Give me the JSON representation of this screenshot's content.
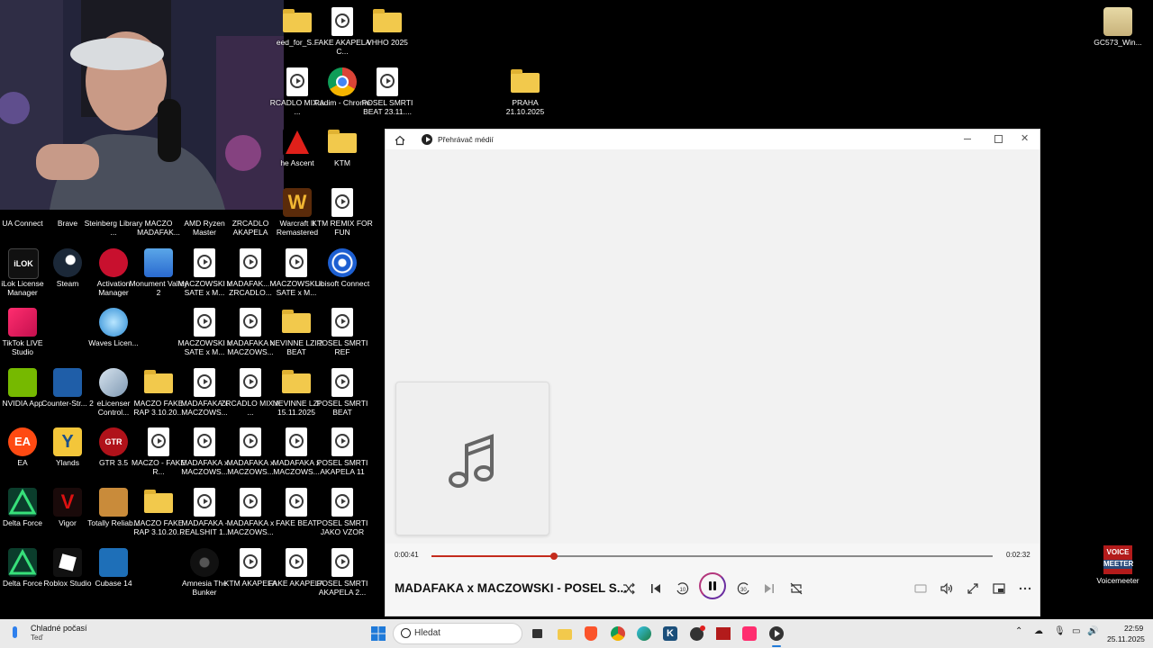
{
  "desktop": {
    "icons_top": [
      {
        "label": "eed_for_S...",
        "type": "folder"
      },
      {
        "label": "FAKE AKAPELA C...",
        "type": "file"
      },
      {
        "label": "VHHO 2025",
        "type": "folder"
      },
      {
        "label": "RCADLO MIX A ...",
        "type": "file"
      },
      {
        "label": "Radim - Chrome",
        "type": "chrome"
      },
      {
        "label": "POSEL SMRTI BEAT 23.11....",
        "type": "file"
      },
      {
        "label": "PRAHA 21.10.2025",
        "type": "folder"
      },
      {
        "label": "he Ascent",
        "type": "app"
      },
      {
        "label": "KTM",
        "type": "folder"
      },
      {
        "label": "Warcraft II Remastered",
        "type": "app"
      },
      {
        "label": "KTM REMIX FOR FUN",
        "type": "file"
      },
      {
        "label": "GC573_Win...",
        "type": "app"
      }
    ],
    "row1": [
      "UA Connect",
      "Brave",
      "Steinberg Library ...",
      "MACZO MADAFAK...",
      "AMD Ryzen Master",
      "ZRCADLO AKAPELA"
    ],
    "row2": [
      "iLok License Manager",
      "Steam",
      "Activation Manager",
      "Monument Valley 2",
      "MACZOWSKI x SATE x M...",
      "MADAFAK... - ZRCADLO...",
      "MACZOWSKI x SATE x M...",
      "Ubisoft Connect"
    ],
    "row3": [
      "TikTok LIVE Studio",
      "Waves Licen...",
      "MACZOWSKI x SATE x M...",
      "MADAFAKA x MACZOWS...",
      "NEVINNE LZI 2 BEAT",
      "POSEL SMRTI REF"
    ],
    "row4": [
      "NVIDIA App",
      "Counter-Str... 2",
      "eLicenser Control...",
      "MACZO FAKE RAP 3.10.20...",
      "MADAFAKA x MACZOWS...",
      "ZRCADLO MIX A ...",
      "NEVINNE LZI 15.11.2025",
      "POSEL SMRTI BEAT"
    ],
    "row5": [
      "EA",
      "Ylands",
      "GTR 3.5",
      "MACZO - FAKE R...",
      "MADAFAKA x MACZOWS...",
      "MADAFAKA x MACZOWS...",
      "MADAFAKA x MACZOWS...",
      "POSEL SMRTI AKAPELA 11"
    ],
    "row6": [
      "Delta Force",
      "Vigor",
      "Totally Reliab...",
      "MACZO FAKE RAP 3.10.20...",
      "MADAFAKA - REALSHIT 1...",
      "MADAFAKA x MACZOWS...",
      "FAKE BEAT",
      "POSEL SMRTI JAKO VZOR"
    ],
    "row7": [
      "Delta Force",
      "Roblox Studio",
      "Cubase 14",
      "Amnesia The Bunker",
      "KTM AKAPELA",
      "FAKE AKAPELA",
      "POSEL SMRTI AKAPELA 2..."
    ],
    "voicemeeter": {
      "label": "Voicemeeter",
      "badge_top": "VOICE",
      "badge_bottom": "MEETER"
    }
  },
  "media_player": {
    "title": "Přehrávač médií",
    "elapsed": "0:00:41",
    "total": "0:02:32",
    "progress": 0.218,
    "song_title": "MADAFAKA x MACZOWSKI - POSEL S...",
    "accent": "#c42b1c"
  },
  "taskbar": {
    "weather_title": "Chladné počasí",
    "weather_sub": "Teď",
    "search_placeholder": "Hledat",
    "time": "22:59",
    "date": "25.11.2025"
  }
}
